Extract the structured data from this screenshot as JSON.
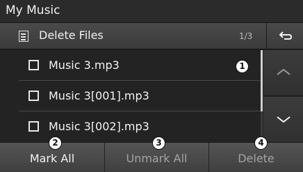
{
  "app": {
    "title": "My Music"
  },
  "header": {
    "label": "Delete Files",
    "icon": "document-list-icon",
    "page_indicator": "1/3",
    "back_icon": "back-arrow-icon"
  },
  "files": [
    {
      "name": "Music 3.mp3",
      "checked": false
    },
    {
      "name": "Music 3[001].mp3",
      "checked": false
    },
    {
      "name": "Music 3[002].mp3",
      "checked": false
    }
  ],
  "scroll": {
    "up_icon": "chevron-up-icon",
    "down_icon": "chevron-down-icon"
  },
  "actions": {
    "mark_all": "Mark All",
    "unmark_all": "Unmark All",
    "delete": "Delete"
  },
  "callouts": [
    "1",
    "2",
    "3",
    "4"
  ],
  "colors": {
    "background": "#232323",
    "text": "#f2f2f2",
    "disabled_text": "#a3a3a3",
    "button": "#4a4a4a"
  }
}
